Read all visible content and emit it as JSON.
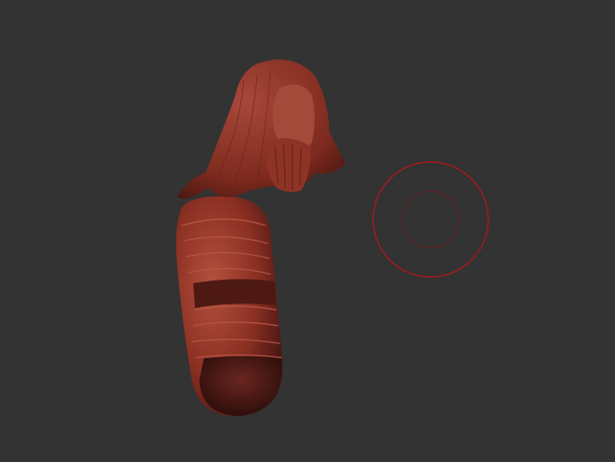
{
  "viewport": {
    "background_color": "#333333",
    "model_color": "#8a2f22",
    "brush_outer_color": "#c0121c",
    "brush_inner_color": "#6a1a1a",
    "brush_icon": "brush-cursor-icon"
  }
}
